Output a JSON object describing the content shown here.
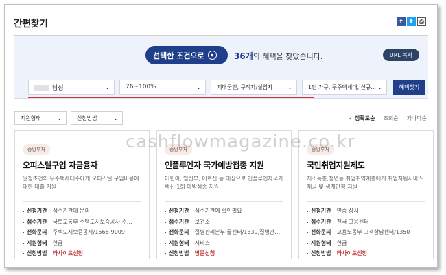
{
  "title": "간편찾기",
  "share": {
    "facebook": "f",
    "twitter": "t",
    "print": "⎙"
  },
  "panel": {
    "cond_label": "선택한 조건으로",
    "result_count": "36개",
    "result_text": "의 혜택을 찾았습니다.",
    "url_copy": "URL 복사",
    "filters": [
      {
        "value": "남성"
      },
      {
        "value": "76~100%"
      },
      {
        "value": "제대군인, 구직자/실업자"
      },
      {
        "value": "1인 가구, 무주택세대, 신규..."
      }
    ],
    "search_button": "혜택찾기"
  },
  "tools": {
    "support_type": "지원형태",
    "apply_method": "신청방법",
    "sort": [
      "정확도순",
      "조회순",
      "가나다순"
    ]
  },
  "watermark": "cashflowmagazine.co.kr",
  "cards": [
    {
      "badge": "중앙부처",
      "title": "오피스텔구입 자금융자",
      "desc": "일정조건의 무주택세대주에게 오피스텔 구입비용에 대한 대출 지원",
      "rows": [
        {
          "k": "신청기간",
          "v": "접수기관에 문의"
        },
        {
          "k": "접수기관",
          "v": "국토교통부 주택도시보증공사 주..."
        },
        {
          "k": "전화문의",
          "v": "주택도시보증공사/1566-9009"
        },
        {
          "k": "지원형태",
          "v": "현금"
        },
        {
          "k": "신청방법",
          "v": "타사이트신청"
        }
      ]
    },
    {
      "badge": "중앙부처",
      "title": "인플루엔자 국가예방접종 지원",
      "desc": "어린이, 임신부, 어르신 등 대상으로 인플루엔자 4가백신 1회 예방접종 지원",
      "rows": [
        {
          "k": "신청기간",
          "v": "접수기관에 확인필요"
        },
        {
          "k": "접수기관",
          "v": "보건소"
        },
        {
          "k": "전화문의",
          "v": "질병관리본부 콜센터/1339,질병관리..."
        },
        {
          "k": "지원형태",
          "v": "서비스"
        },
        {
          "k": "신청방법",
          "v": "방문신청"
        }
      ]
    },
    {
      "badge": "중앙부처",
      "title": "국민취업지원제도",
      "desc": "저소득층,청년등 취업취약계층에게 취업지원서비스 제공 및 생계안정 지원",
      "rows": [
        {
          "k": "신청기간",
          "v": "연중 상시"
        },
        {
          "k": "접수기관",
          "v": "전국 고용센터"
        },
        {
          "k": "전화문의",
          "v": "고용노동부 고객상담센터/1350"
        },
        {
          "k": "지원형태",
          "v": "현금"
        },
        {
          "k": "신청방법",
          "v": "타사이트신청"
        }
      ]
    }
  ]
}
